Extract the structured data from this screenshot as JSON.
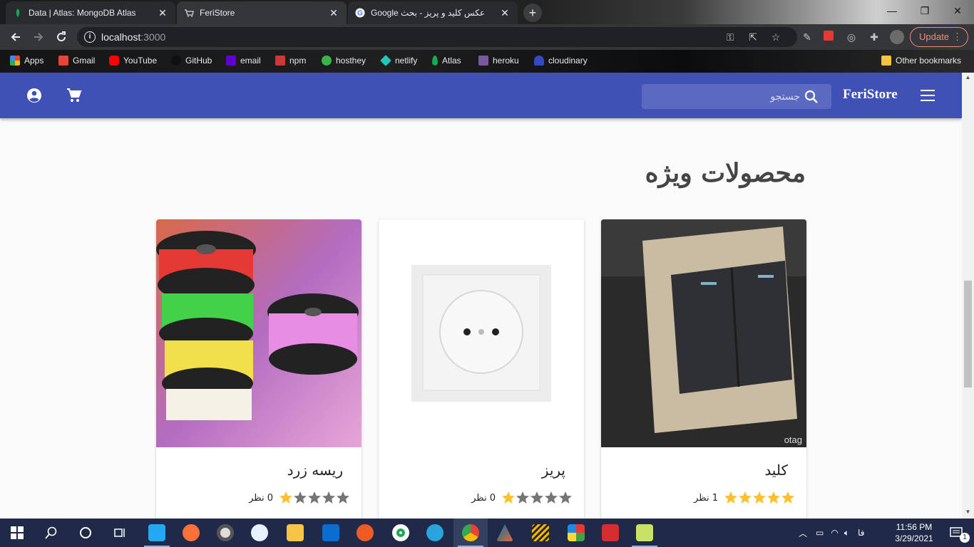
{
  "browser": {
    "tabs": [
      {
        "title": "Data | Atlas: MongoDB Atlas",
        "active": false
      },
      {
        "title": "FeriStore",
        "active": true
      },
      {
        "title": "عکس کلید و پریز - بحث Google",
        "active": false
      }
    ],
    "new_tab_label": "+",
    "url_host": "localhost",
    "url_port": ":3000",
    "update_label": "Update",
    "bookmarks": [
      {
        "label": "Apps",
        "icon": "apps-grid-icon",
        "color": "#4285f4"
      },
      {
        "label": "Gmail",
        "icon": "gmail-icon",
        "color": "#ea4335"
      },
      {
        "label": "YouTube",
        "icon": "youtube-icon",
        "color": "#ff0000"
      },
      {
        "label": "GitHub",
        "icon": "github-icon",
        "color": "#111111"
      },
      {
        "label": "email",
        "icon": "yahoo-icon",
        "color": "#6001d2"
      },
      {
        "label": "npm",
        "icon": "npm-icon",
        "color": "#cb3837"
      },
      {
        "label": "hosthey",
        "icon": "hosthey-icon",
        "color": "#3bb44a"
      },
      {
        "label": "netlify",
        "icon": "netlify-icon",
        "color": "#20c6b7"
      },
      {
        "label": "Atlas",
        "icon": "leaf-icon",
        "color": "#13aa52"
      },
      {
        "label": "heroku",
        "icon": "heroku-icon",
        "color": "#79589f"
      },
      {
        "label": "cloudinary",
        "icon": "cloudinary-icon",
        "color": "#3448c5"
      }
    ],
    "other_bookmarks": "Other bookmarks"
  },
  "app": {
    "brand": "FeriStore",
    "search_placeholder": "جستجو",
    "primary_color": "#3f51b5",
    "section_title": "محصولات ویژه",
    "products": [
      {
        "name": "کلید",
        "rating": 5,
        "reviews_count": "1",
        "reviews_label": "نظر",
        "image": "light-switch"
      },
      {
        "name": "پریز",
        "rating": 1,
        "reviews_count": "0",
        "reviews_label": "نظر",
        "image": "power-socket"
      },
      {
        "name": "ریسه زرد",
        "rating": 1,
        "reviews_count": "0",
        "reviews_label": "نظر",
        "image": "led-strip-reels"
      }
    ]
  },
  "taskbar": {
    "language": "فا",
    "time": "11:56 PM",
    "date": "3/29/2021",
    "notification_count": "1"
  }
}
